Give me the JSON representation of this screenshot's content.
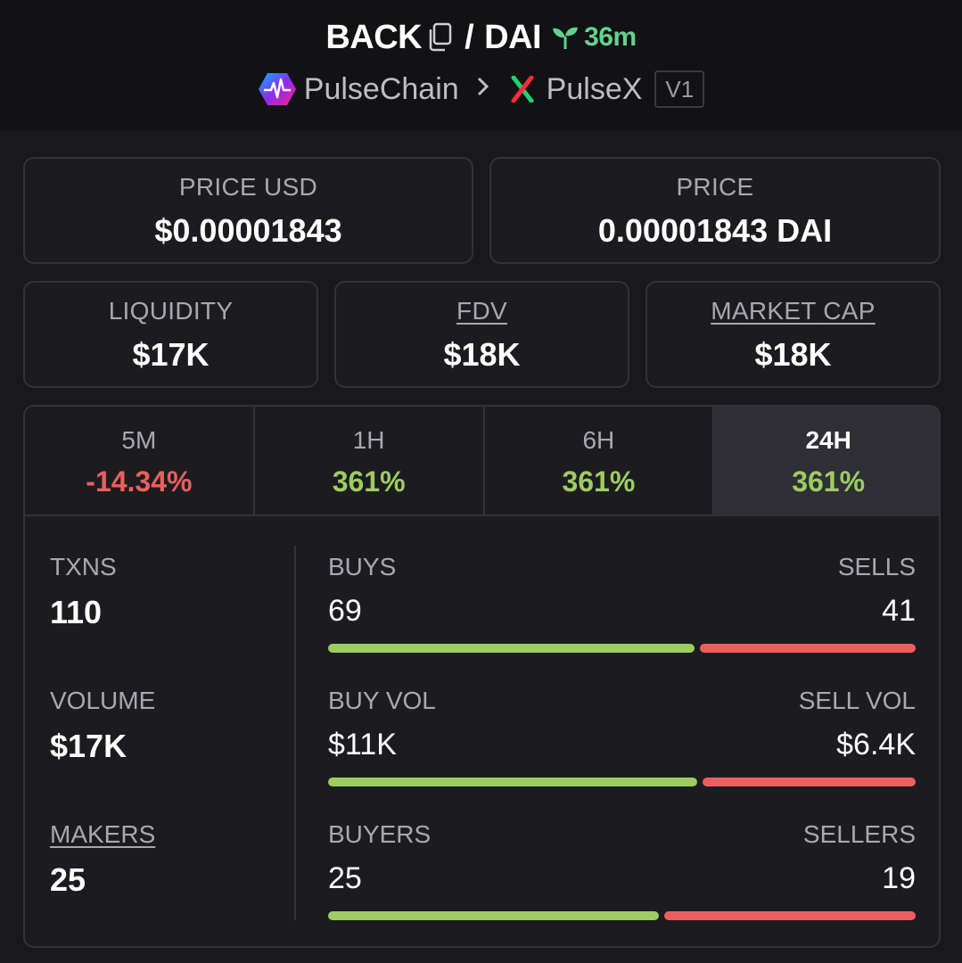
{
  "header": {
    "base_token": "BACK",
    "separator": "/",
    "quote_token": "DAI",
    "age": "36m",
    "chain": "PulseChain",
    "dex": "PulseX",
    "version": "V1"
  },
  "price_usd": {
    "label": "PRICE USD",
    "value": "$0.00001843"
  },
  "price": {
    "label": "PRICE",
    "value": "0.00001843 DAI"
  },
  "liquidity": {
    "label": "LIQUIDITY",
    "value": "$17K"
  },
  "fdv": {
    "label": "FDV",
    "value": "$18K"
  },
  "market_cap": {
    "label": "MARKET CAP",
    "value": "$18K"
  },
  "tabs": [
    {
      "label": "5M",
      "value": "-14.34%",
      "trend": "negative"
    },
    {
      "label": "1H",
      "value": "361%",
      "trend": "positive"
    },
    {
      "label": "6H",
      "value": "361%",
      "trend": "positive"
    },
    {
      "label": "24H",
      "value": "361%",
      "trend": "positive",
      "active": true
    }
  ],
  "txns": {
    "label": "TXNS",
    "value": "110"
  },
  "volume": {
    "label": "VOLUME",
    "value": "$17K"
  },
  "makers": {
    "label": "MAKERS",
    "value": "25"
  },
  "txn_split": {
    "left_label": "BUYS",
    "right_label": "SELLS",
    "left_value": "69",
    "right_value": "41",
    "buy_fraction": 0.628
  },
  "vol_split": {
    "left_label": "BUY VOL",
    "right_label": "SELL VOL",
    "left_value": "$11K",
    "right_value": "$6.4K",
    "buy_fraction": 0.633
  },
  "maker_split": {
    "left_label": "BUYERS",
    "right_label": "SELLERS",
    "left_value": "25",
    "right_value": "19",
    "buy_fraction": 0.568
  },
  "colors": {
    "positive": "#9dcc61",
    "negative": "#ec5f5f",
    "age": "#63d18f"
  }
}
